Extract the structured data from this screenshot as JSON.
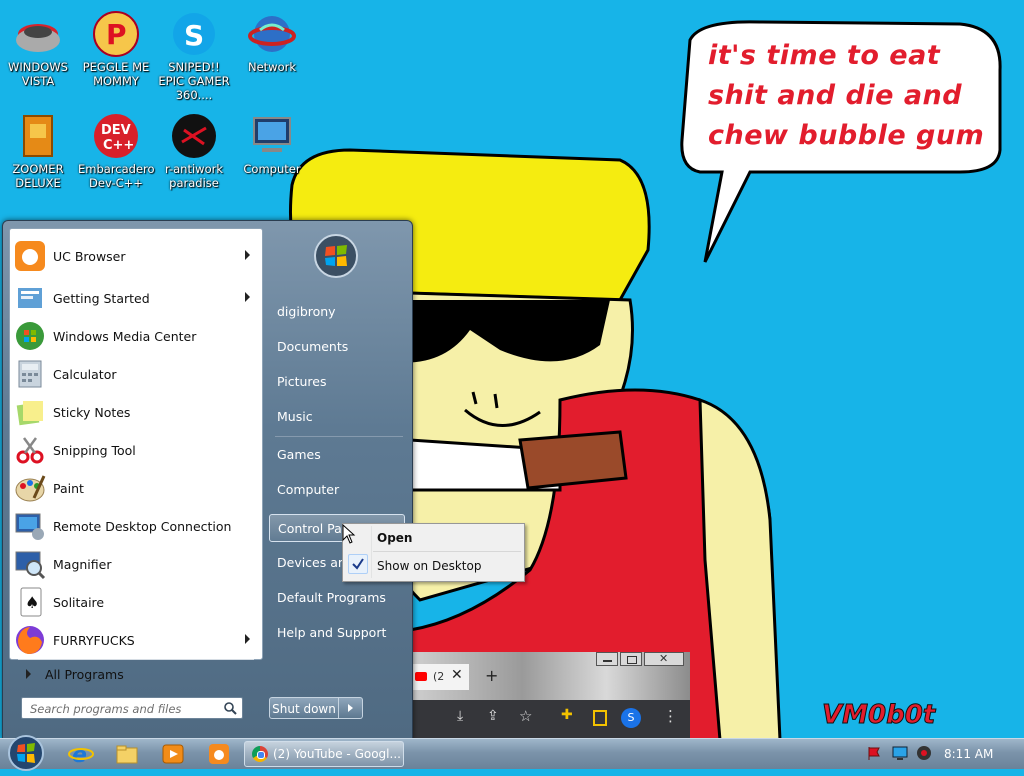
{
  "wallpaper": {
    "speech_text": "it's time to eat shit and die and chew bubble gum",
    "signature": "VM0b0t",
    "colors": {
      "sky": "#17b4e8",
      "hat": "#f5ec10",
      "skin": "#f6f0a8",
      "shirt": "#e21d2d",
      "text": "#e21d2d"
    }
  },
  "desktop_icons": [
    {
      "id": "windows-vista",
      "label": "WINDOWS VISTA",
      "icon": "bowl-icon"
    },
    {
      "id": "peggle",
      "label": "PEGGLE ME MOMMY",
      "icon": "peggle-icon"
    },
    {
      "id": "sniped",
      "label": "SNIPED!! EPIC GAMER 360....",
      "icon": "skype-icon"
    },
    {
      "id": "network",
      "label": "Network",
      "icon": "network-icon"
    },
    {
      "id": "zoomer",
      "label": "ZOOMER DELUXE",
      "icon": "zoomer-icon"
    },
    {
      "id": "devcpp",
      "label": "Embarcadero Dev-C++",
      "icon": "devcpp-icon"
    },
    {
      "id": "antiwork",
      "label": "r-antiwork paradise",
      "icon": "antiwork-icon"
    },
    {
      "id": "computer",
      "label": "Computer",
      "icon": "computer-icon"
    }
  ],
  "start_menu": {
    "programs": [
      {
        "label": "UC Browser",
        "icon": "uc-browser-icon",
        "submenu": true
      },
      {
        "label": "Getting Started",
        "icon": "getting-started-icon",
        "submenu": true
      },
      {
        "label": "Windows Media Center",
        "icon": "media-center-icon",
        "submenu": false
      },
      {
        "label": "Calculator",
        "icon": "calculator-icon",
        "submenu": false
      },
      {
        "label": "Sticky Notes",
        "icon": "sticky-notes-icon",
        "submenu": false
      },
      {
        "label": "Snipping Tool",
        "icon": "snipping-tool-icon",
        "submenu": false
      },
      {
        "label": "Paint",
        "icon": "paint-icon",
        "submenu": false
      },
      {
        "label": "Remote Desktop Connection",
        "icon": "remote-desktop-icon",
        "submenu": false
      },
      {
        "label": "Magnifier",
        "icon": "magnifier-icon",
        "submenu": false
      },
      {
        "label": "Solitaire",
        "icon": "solitaire-icon",
        "submenu": false
      },
      {
        "label": "FURRYFUCKS",
        "icon": "firefox-icon",
        "submenu": true
      }
    ],
    "all_programs": "All Programs",
    "search_placeholder": "Search programs and files",
    "right_items": {
      "user": "digibrony",
      "documents": "Documents",
      "pictures": "Pictures",
      "music": "Music",
      "games": "Games",
      "computer": "Computer",
      "control_panel": "Control Panel",
      "devices": "Devices and Printers",
      "default_programs": "Default Programs",
      "help": "Help and Support"
    },
    "shutdown": "Shut down"
  },
  "context_menu": {
    "open": "Open",
    "show_on_desktop": "Show on Desktop",
    "show_on_desktop_checked": true
  },
  "browser_preview": {
    "tab_text": "(2",
    "profile_initial": "S"
  },
  "taskbar": {
    "active_window": "(2) YouTube - Googl...",
    "clock": "8:11 AM"
  }
}
